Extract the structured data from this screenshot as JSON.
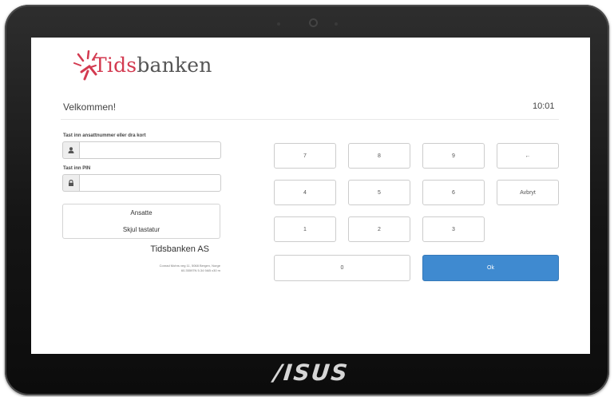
{
  "brand": {
    "name_prefix": "Tids",
    "name_suffix": "banken"
  },
  "header": {
    "welcome": "Velkommen!",
    "time": "10:01"
  },
  "form": {
    "employee_label": "Tast inn ansattnummer eller dra kort",
    "employee_value": "",
    "pin_label": "Tast inn PIN",
    "pin_value": ""
  },
  "buttons": {
    "employees": "Ansatte",
    "hide_keyboard": "Skjul tastatur"
  },
  "company": {
    "name": "Tidsbanken AS",
    "address": "Conrad Mohrs veg 11, 5068 Bergen, Norge",
    "coords": "60.35597N 5.34 9AB x30 m"
  },
  "keypad": {
    "k7": "7",
    "k8": "8",
    "k9": "9",
    "backspace": "←",
    "k4": "4",
    "k5": "5",
    "k6": "6",
    "cancel": "Avbryt",
    "k1": "1",
    "k2": "2",
    "k3": "3",
    "k0": "0",
    "ok": "Ok"
  },
  "device": {
    "logo": "/ISUS"
  },
  "colors": {
    "brand_red": "#d33a50",
    "ok_blue": "#3f8ad0"
  },
  "icons": {
    "employee_field": "user-icon",
    "pin_field": "lock-icon",
    "logo_mark": "sunburst-logo"
  }
}
